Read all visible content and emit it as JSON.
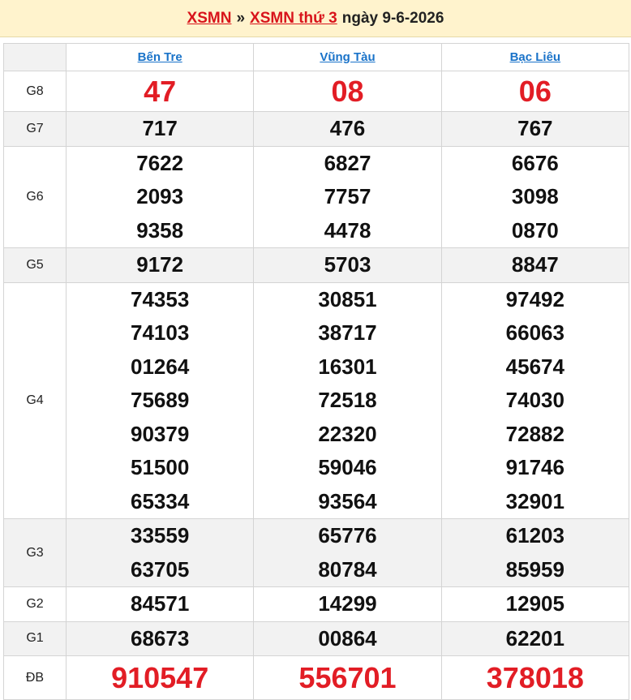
{
  "header": {
    "link1": "XSMN",
    "sep": "»",
    "link2": "XSMN thứ 3",
    "date": "ngày 9-6-2026"
  },
  "provinces": [
    "Bến Tre",
    "Vũng Tàu",
    "Bạc Liêu"
  ],
  "rows": [
    {
      "label": "G8",
      "values": [
        [
          "47"
        ],
        [
          "08"
        ],
        [
          "06"
        ]
      ]
    },
    {
      "label": "G7",
      "values": [
        [
          "717"
        ],
        [
          "476"
        ],
        [
          "767"
        ]
      ]
    },
    {
      "label": "G6",
      "values": [
        [
          "7622",
          "2093",
          "9358"
        ],
        [
          "6827",
          "7757",
          "4478"
        ],
        [
          "6676",
          "3098",
          "0870"
        ]
      ]
    },
    {
      "label": "G5",
      "values": [
        [
          "9172"
        ],
        [
          "5703"
        ],
        [
          "8847"
        ]
      ]
    },
    {
      "label": "G4",
      "values": [
        [
          "74353",
          "74103",
          "01264",
          "75689",
          "90379",
          "51500",
          "65334"
        ],
        [
          "30851",
          "38717",
          "16301",
          "72518",
          "22320",
          "59046",
          "93564"
        ],
        [
          "97492",
          "66063",
          "45674",
          "74030",
          "72882",
          "91746",
          "32901"
        ]
      ]
    },
    {
      "label": "G3",
      "values": [
        [
          "33559",
          "63705"
        ],
        [
          "65776",
          "80784"
        ],
        [
          "61203",
          "85959"
        ]
      ]
    },
    {
      "label": "G2",
      "values": [
        [
          "84571"
        ],
        [
          "14299"
        ],
        [
          "12905"
        ]
      ]
    },
    {
      "label": "G1",
      "values": [
        [
          "68673"
        ],
        [
          "00864"
        ],
        [
          "62201"
        ]
      ]
    },
    {
      "label": "ĐB",
      "values": [
        [
          "910547"
        ],
        [
          "556701"
        ],
        [
          "378018"
        ]
      ]
    }
  ],
  "colors": {
    "red": "#e21d25",
    "link_blue": "#1a73c9",
    "header_bg": "#fff3cd"
  }
}
